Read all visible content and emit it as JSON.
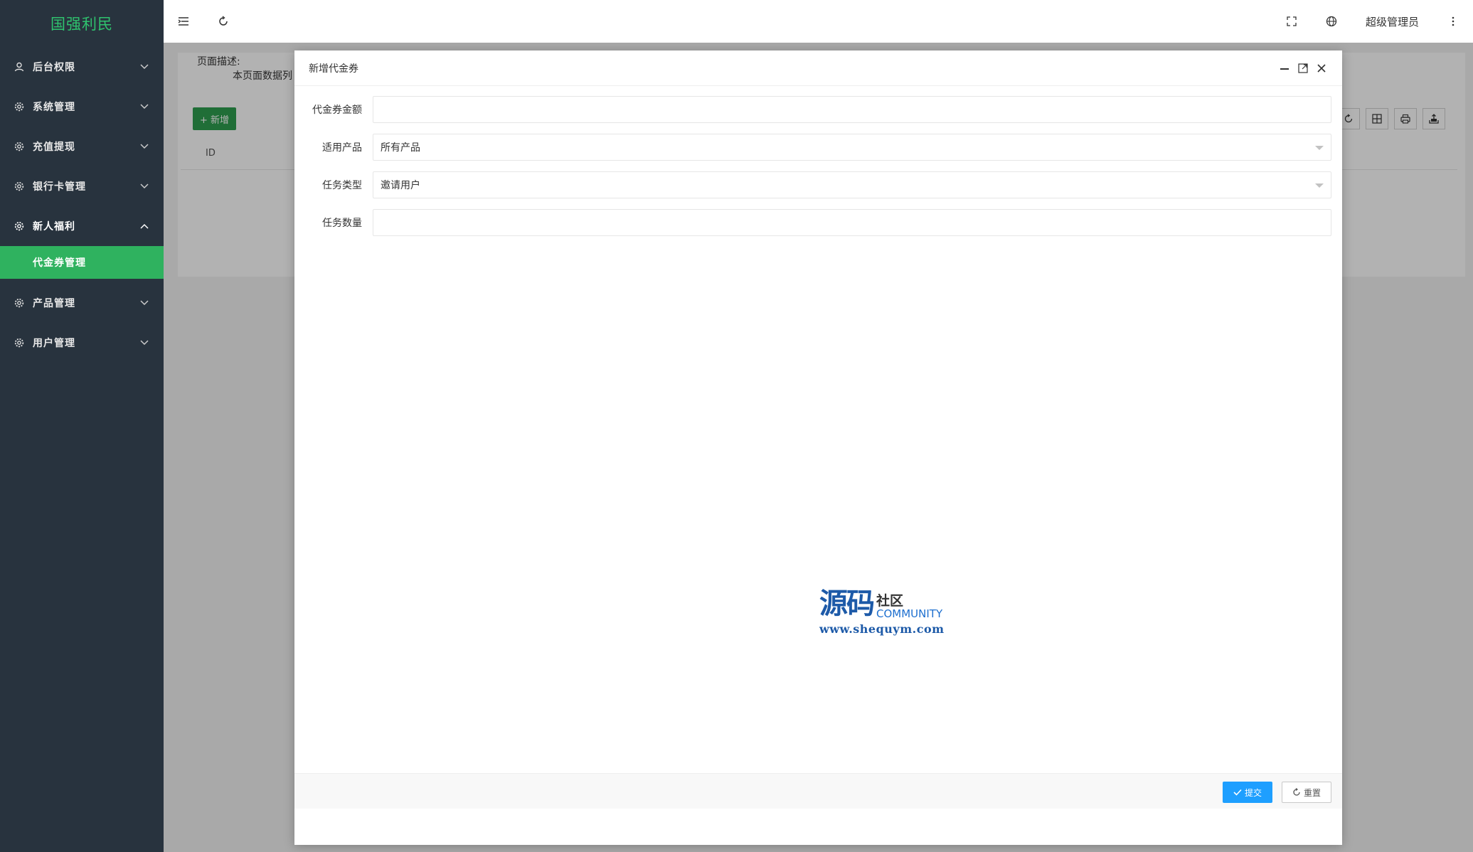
{
  "sidebar": {
    "logo": "国强利民",
    "items": [
      {
        "label": "后台权限",
        "icon": "user-icon"
      },
      {
        "label": "系统管理",
        "icon": "gear-icon"
      },
      {
        "label": "充值提现",
        "icon": "gear-icon"
      },
      {
        "label": "银行卡管理",
        "icon": "gear-icon"
      },
      {
        "label": "新人福利",
        "icon": "gear-icon",
        "open": true
      },
      {
        "label": "产品管理",
        "icon": "gear-icon"
      },
      {
        "label": "用户管理",
        "icon": "gear-icon"
      }
    ],
    "submenu": [
      {
        "label": "代金券管理",
        "active": true
      }
    ]
  },
  "header": {
    "user": "超级管理员"
  },
  "page": {
    "desc_title": "页面描述:",
    "desc_line": "本页面数据列",
    "add_button": "+ 新增",
    "table_col_id": "ID"
  },
  "modal": {
    "title": "新增代金券",
    "fields": [
      {
        "label": "代金券金额",
        "value": ""
      },
      {
        "label": "适用产品",
        "value": "所有产品",
        "type": "select"
      },
      {
        "label": "任务类型",
        "value": "邀请用户",
        "type": "select"
      },
      {
        "label": "任务数量",
        "value": ""
      }
    ],
    "submit_label": "提交",
    "reset_label": "重置"
  },
  "watermark": {
    "big": "源码",
    "cn": "社区",
    "en": "COMMUNITY",
    "url": "www.shequym.com"
  },
  "colors": {
    "sidebar_bg": "#28333e",
    "logo": "#2fc26e",
    "active_menu": "#2fb25f",
    "submit": "#1e9fff"
  }
}
